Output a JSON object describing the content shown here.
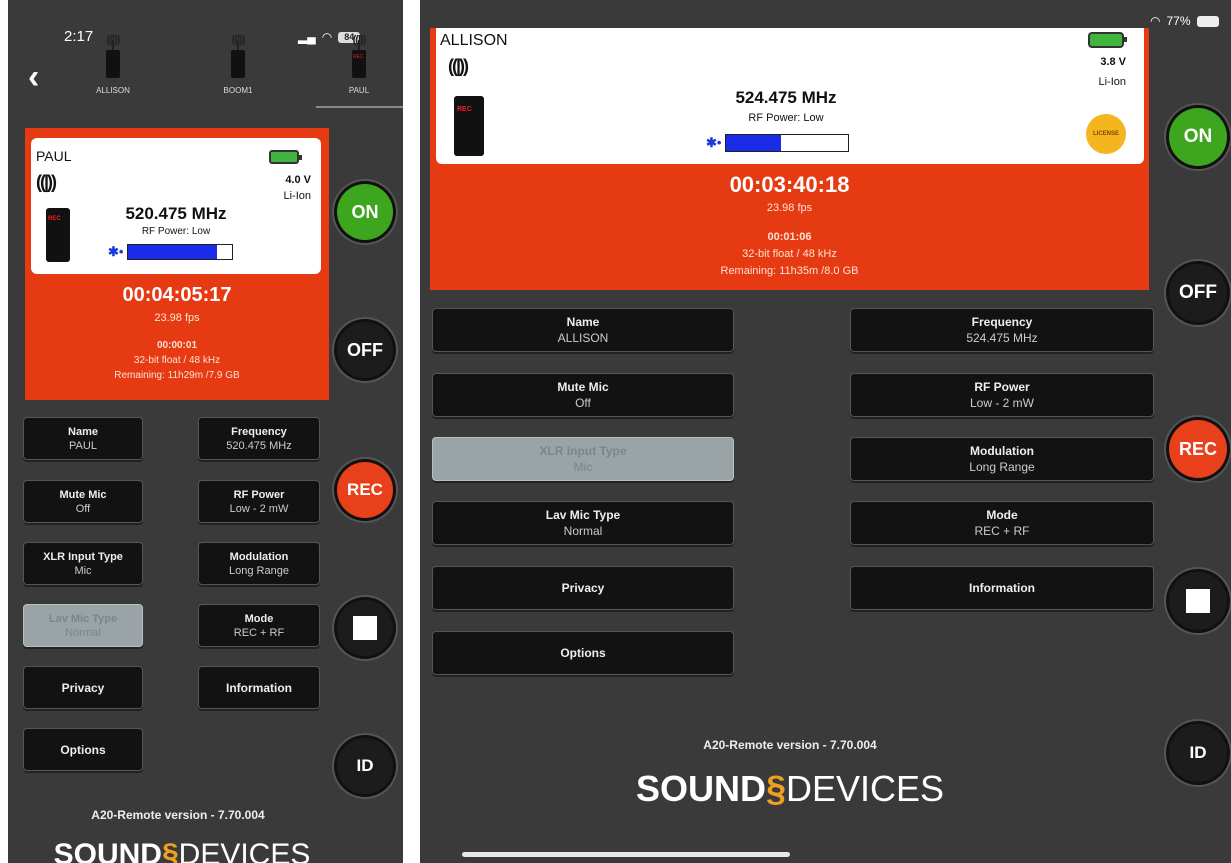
{
  "phone": {
    "time": "2:17",
    "battery": "84",
    "tabs": [
      {
        "label": "ALLISON"
      },
      {
        "label": "BOOM1"
      },
      {
        "label": "PAUL"
      }
    ],
    "card": {
      "name": "PAUL",
      "frequency": "520.475 MHz",
      "rf_power": "RF Power: Low",
      "battery_voltage": "4.0 V",
      "battery_type": "Li-Ion",
      "audio_level": 0.85
    },
    "timecode": "00:04:05:17",
    "fps": "23.98 fps",
    "elapsed": "00:00:01",
    "format": "32-bit float / 48 kHz",
    "remaining": "Remaining: 11h29m /7.9 GB",
    "buttons": [
      {
        "title": "Name",
        "value": "PAUL"
      },
      {
        "title": "Frequency",
        "value": "520.475 MHz"
      },
      {
        "title": "Mute Mic",
        "value": "Off"
      },
      {
        "title": "RF Power",
        "value": "Low - 2 mW"
      },
      {
        "title": "XLR Input Type",
        "value": "Mic"
      },
      {
        "title": "Modulation",
        "value": "Long Range"
      },
      {
        "title": "Lav Mic Type",
        "value": "Normal"
      },
      {
        "title": "Mode",
        "value": "REC + RF"
      },
      {
        "title": "Privacy",
        "value": ""
      },
      {
        "title": "Information",
        "value": ""
      },
      {
        "title": "Options",
        "value": ""
      }
    ],
    "side": {
      "on": "ON",
      "off": "OFF",
      "rec": "REC",
      "id": "ID"
    },
    "version": "A20-Remote version - 7.70.004",
    "brand_left": "SOUND",
    "brand_right": "DEVICES"
  },
  "tablet": {
    "status_wifi_battery": "77%",
    "card": {
      "name": "ALLISON",
      "frequency": "524.475 MHz",
      "rf_power": "RF Power: Low",
      "battery_voltage": "3.8 V",
      "battery_type": "Li-Ion",
      "license": "LICENSE",
      "audio_level": 0.45
    },
    "timecode": "00:03:40:18",
    "fps": "23.98 fps",
    "elapsed": "00:01:06",
    "format": "32-bit float / 48 kHz",
    "remaining": "Remaining: 11h35m /8.0 GB",
    "buttons": [
      {
        "title": "Name",
        "value": "ALLISON"
      },
      {
        "title": "Frequency",
        "value": "524.475 MHz"
      },
      {
        "title": "Mute Mic",
        "value": "Off"
      },
      {
        "title": "RF Power",
        "value": "Low - 2 mW"
      },
      {
        "title": "XLR Input Type",
        "value": "Mic"
      },
      {
        "title": "Modulation",
        "value": "Long Range"
      },
      {
        "title": "Lav Mic Type",
        "value": "Normal"
      },
      {
        "title": "Mode",
        "value": "REC + RF"
      },
      {
        "title": "Privacy",
        "value": ""
      },
      {
        "title": "Information",
        "value": ""
      },
      {
        "title": "Options",
        "value": ""
      }
    ],
    "side": {
      "on": "ON",
      "off": "OFF",
      "rec": "REC",
      "id": "ID"
    },
    "version": "A20-Remote version - 7.70.004",
    "brand_left": "SOUND",
    "brand_right": "DEVICES"
  }
}
